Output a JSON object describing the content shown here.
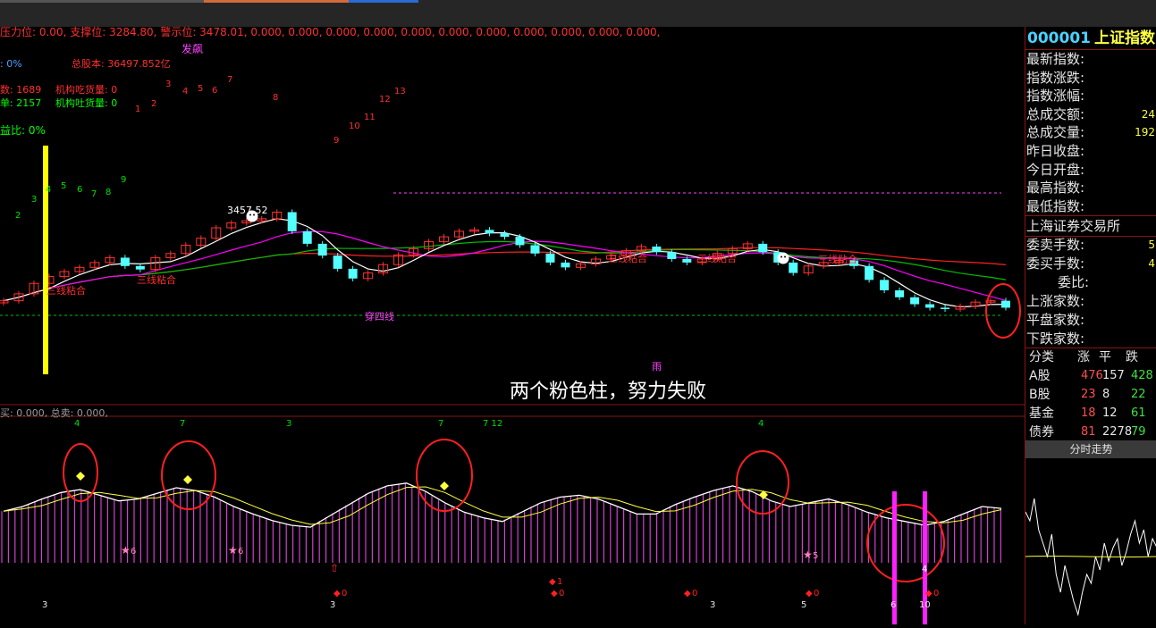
{
  "top_indicator": {
    "text": "压力位: 0.00, 支撑位: 3284.80, 警示位: 3478.01, 0.000, 0.000, 0.000, 0.000, 0.000, 0.000, 0.000, 0.000, 0.000, 0.000, 0.000,"
  },
  "info": {
    "ratio": ": 0%",
    "capital": "总股本: 36497.852亿",
    "count_label": "数: 1689",
    "inst_buy": "机构吃货量: 0",
    "single": "单: 2157",
    "inst_sell": "机构吐货量: 0",
    "profit_ratio": "益比: 0%",
    "signal_fa": "发飙"
  },
  "annotations": {
    "peak_price": "3457.52",
    "sanxian": "三线粘合",
    "sanxian2": "三线粘合",
    "sanxian3": "三线粘合",
    "sanxian4": "三线粘合",
    "sanxian5": "三线粘合",
    "chuansixian": "穿四线",
    "yu": "雨",
    "caption": "两个粉色柱，努力失败",
    "lower_header": "买: 0.000, 总卖: 0.000,"
  },
  "count_labels_green": [
    "2",
    "3",
    "4",
    "5",
    "6",
    "7",
    "8",
    "9"
  ],
  "count_labels_red": [
    "3",
    "4",
    "5",
    "6",
    "7",
    "8",
    "9",
    "10",
    "11",
    "12",
    "13",
    "1",
    "2"
  ],
  "lower_labels": {
    "top": [
      "4",
      "7",
      "3",
      "7",
      "7 12",
      "4"
    ],
    "stars": [
      "6",
      "6",
      "5"
    ],
    "diamonds": [
      "0",
      "1",
      "0",
      "0",
      "0",
      "0"
    ],
    "bottom": [
      "3",
      "3",
      "3",
      "5",
      "6",
      "10"
    ],
    "side_num": "4"
  },
  "sidebar": {
    "code": "000001",
    "name": "上证指数",
    "rows": [
      {
        "label": "最新指数:",
        "value": ""
      },
      {
        "label": "指数涨跌:",
        "value": ""
      },
      {
        "label": "指数涨幅:",
        "value": ""
      },
      {
        "label": "总成交额:",
        "value": "24"
      },
      {
        "label": "总成交量:",
        "value": "192"
      },
      {
        "label": "昨日收盘:",
        "value": ""
      },
      {
        "label": "今日开盘:",
        "value": ""
      },
      {
        "label": "最高指数:",
        "value": ""
      },
      {
        "label": "最低指数:",
        "value": ""
      }
    ],
    "exchange": "上海证券交易所",
    "rows2": [
      {
        "label": "委卖手数:",
        "value": "5"
      },
      {
        "label": "委买手数:",
        "value": "4"
      },
      {
        "label": "委比:",
        "value": ""
      },
      {
        "label": "上涨家数:",
        "value": ""
      },
      {
        "label": "平盘家数:",
        "value": ""
      },
      {
        "label": "下跌家数:",
        "value": ""
      }
    ],
    "stats_header": [
      "分类",
      "涨",
      "平",
      "跌"
    ],
    "stats": [
      {
        "cat": "A股",
        "up": "476",
        "flat": "157",
        "down": "428"
      },
      {
        "cat": "B股",
        "up": "23",
        "flat": "8",
        "down": "22"
      },
      {
        "cat": "基金",
        "up": "18",
        "flat": "12",
        "down": "61"
      },
      {
        "cat": "债券",
        "up": "81",
        "flat": "2278",
        "down": "79"
      }
    ],
    "tab_label": "分时走势"
  },
  "colors": {
    "up": "#ff3232",
    "down": "#54ffff",
    "ma_white": "#ffffff",
    "ma_magenta": "#ff00ff",
    "ma_green": "#00c000",
    "ma_red": "#ff2020",
    "osc_bar": "#d040d0",
    "highlight_yellow": "#ffff00"
  },
  "chart_data": {
    "type": "candlestick",
    "title": "",
    "series": [
      {
        "name": "K线",
        "values": [
          3330,
          3340,
          3355,
          3365,
          3372,
          3378,
          3385,
          3392,
          3380,
          3375,
          3392,
          3398,
          3410,
          3420,
          3435,
          3442,
          3445,
          3448,
          3457.52,
          3430,
          3412,
          3395,
          3376,
          3362,
          3370,
          3382,
          3396,
          3405,
          3415,
          3422,
          3430,
          3432,
          3427,
          3422,
          3410,
          3398,
          3385,
          3378,
          3383,
          3390,
          3395,
          3402,
          3408,
          3400,
          3390,
          3385,
          3390,
          3398,
          3405,
          3412,
          3400,
          3385,
          3370,
          3380,
          3385,
          3388,
          3380,
          3360,
          3345,
          3335,
          3325,
          3320,
          3318,
          3322,
          3328,
          3330,
          3320
        ]
      }
    ],
    "oscillator": [
      55,
      60,
      68,
      75,
      78,
      72,
      66,
      68,
      74,
      80,
      77,
      70,
      60,
      52,
      45,
      40,
      38,
      50,
      62,
      74,
      82,
      85,
      76,
      64,
      54,
      48,
      44,
      54,
      64,
      70,
      72,
      68,
      60,
      52,
      52,
      62,
      70,
      77,
      82,
      76,
      66,
      60,
      64,
      68,
      62,
      54,
      48,
      44,
      40,
      44,
      52,
      60,
      58
    ]
  }
}
